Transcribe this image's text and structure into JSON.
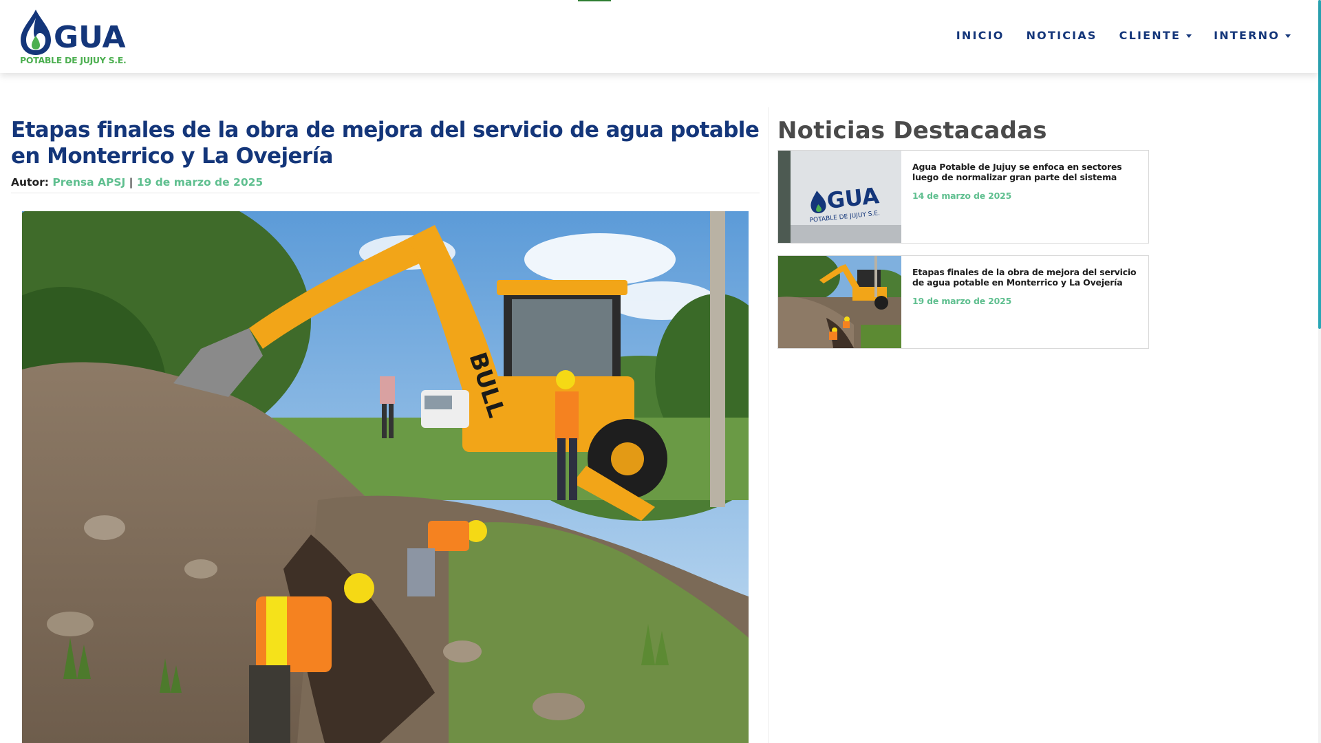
{
  "header": {
    "logo_text": "GUA",
    "logo_subtitle": "POTABLE DE JUJUY S.E.",
    "nav": [
      {
        "label": "INICIO",
        "dropdown": false
      },
      {
        "label": "NOTICIAS",
        "dropdown": false
      },
      {
        "label": "CLIENTE",
        "dropdown": true
      },
      {
        "label": "INTERNO",
        "dropdown": true
      }
    ]
  },
  "article": {
    "title": "Etapas finales de la obra de mejora del servicio de agua potable en Monterrico y La Ovejería",
    "author_label": "Autor:",
    "author": "Prensa APSJ",
    "separator": "|",
    "date": "19 de marzo de 2025",
    "image_alt": "backhoe-and-workers-digging-trench"
  },
  "sidebar": {
    "title": "Noticias Destacadas",
    "cards": [
      {
        "title": "Agua Potable de Jujuy se enfoca en sectores luego de normalizar gran parte del sistema",
        "date": "14 de marzo de 2025",
        "thumb_text": "GUA",
        "thumb_sub": "POTABLE DE JUJUY S.E."
      },
      {
        "title": "Etapas finales de la obra de mejora del servicio de agua potable en Monterrico y La Ovejería",
        "date": "19 de marzo de 2025"
      }
    ]
  },
  "colors": {
    "brand_blue": "#14367a",
    "accent_green": "#5fbf8f",
    "logo_green": "#4caf50",
    "scroll_accent": "#2aa6b5"
  }
}
